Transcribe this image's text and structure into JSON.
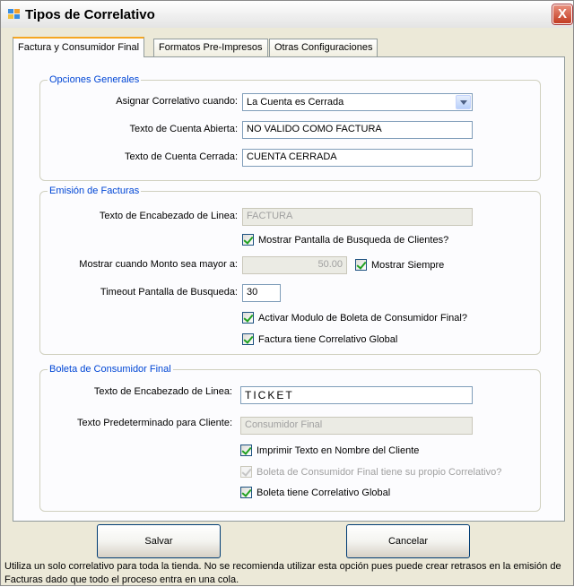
{
  "window": {
    "title": "Tipos de Correlativo",
    "close_glyph": "X"
  },
  "tabs": [
    {
      "label": "Factura y Consumidor Final",
      "active": true
    },
    {
      "label": "Formatos Pre-Impresos",
      "active": false
    },
    {
      "label": "Otras Configuraciones",
      "active": false
    }
  ],
  "opciones_generales": {
    "title": "Opciones Generales",
    "asignar_label": "Asignar Correlativo cuando:",
    "asignar_value": "La Cuenta es Cerrada",
    "abierta_label": "Texto de Cuenta Abierta:",
    "abierta_value": "NO VALIDO COMO FACTURA",
    "cerrada_label": "Texto de Cuenta Cerrada:",
    "cerrada_value": "CUENTA CERRADA"
  },
  "emision": {
    "title": "Emisión de Facturas",
    "encabezado_label": "Texto de Encabezado de Linea:",
    "encabezado_value": "FACTURA",
    "mostrar_busqueda_label": "Mostrar Pantalla de Busqueda de Clientes?",
    "monto_label": "Mostrar cuando Monto sea mayor a:",
    "monto_value": "50.00",
    "mostrar_siempre_label": "Mostrar Siempre",
    "timeout_label": "Timeout Pantalla de Busqueda:",
    "timeout_value": "30",
    "activar_boleta_label": "Activar Modulo de Boleta de Consumidor Final?",
    "factura_global_label": "Factura tiene Correlativo Global"
  },
  "boleta": {
    "title": "Boleta de Consumidor Final",
    "encabezado_label": "Texto de Encabezado de Linea:",
    "encabezado_value": "TICKET",
    "cliente_label": "Texto Predeterminado para Cliente:",
    "cliente_value": "Consumidor Final",
    "imprimir_label": "Imprimir Texto en Nombre del Cliente",
    "propio_label": "Boleta de Consumidor Final tiene su propio Correlativo?",
    "global_label": "Boleta tiene Correlativo Global"
  },
  "buttons": {
    "save": "Salvar",
    "cancel": "Cancelar"
  },
  "status_text": "Utiliza un solo correlativo para toda la tienda. No se recomienda utilizar esta opción pues puede crear retrasos en la emisión de Facturas dado que todo el proceso entra en una cola."
}
